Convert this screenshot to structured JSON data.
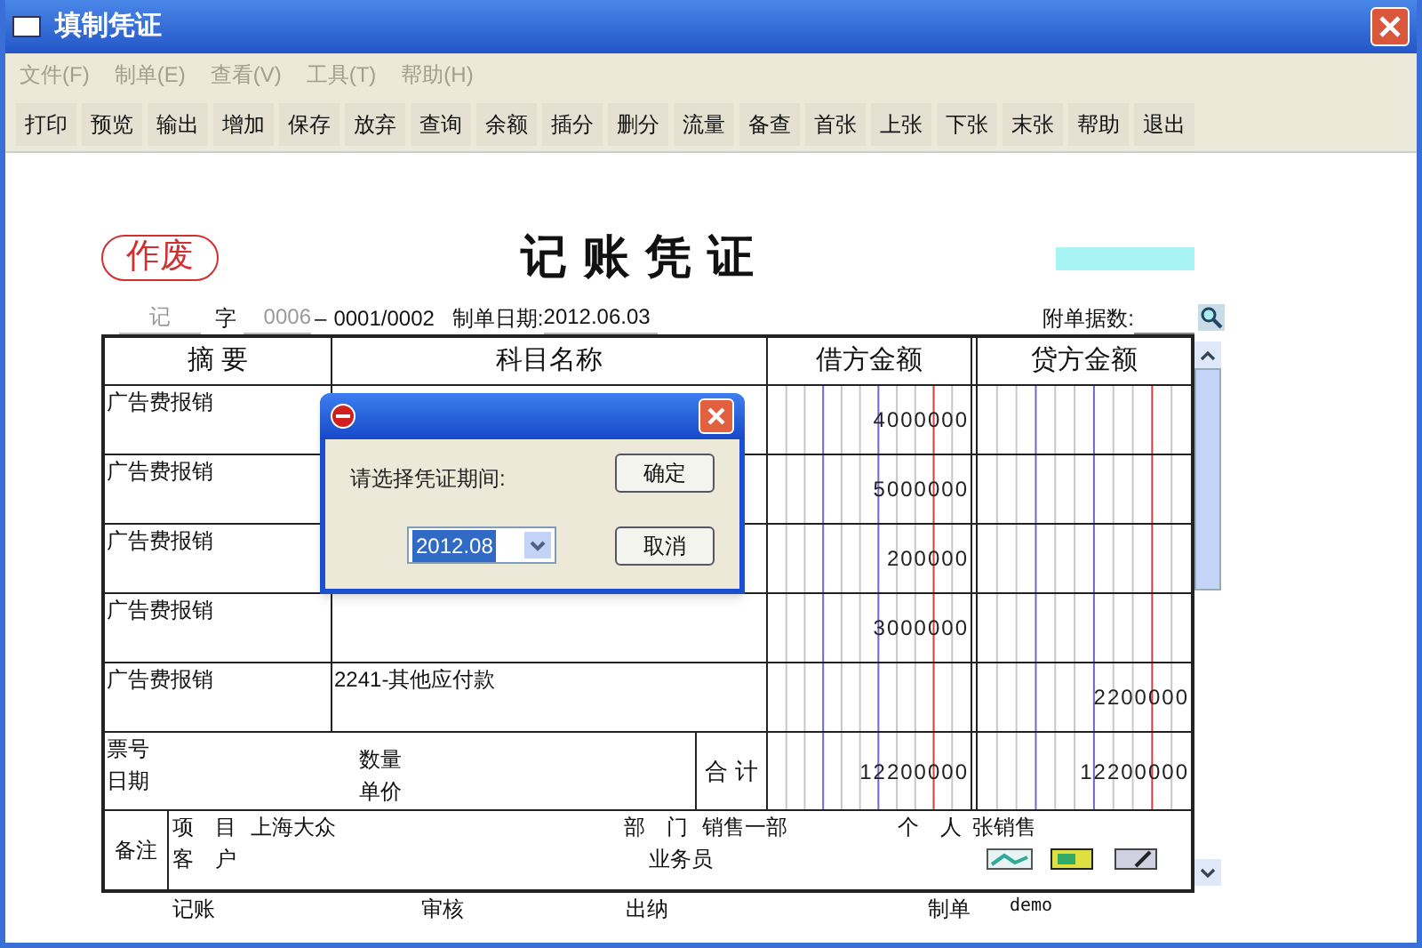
{
  "window": {
    "title": "填制凭证"
  },
  "menu": [
    {
      "label": "文件(F)",
      "disabled": true
    },
    {
      "label": "制单(E)",
      "disabled": true
    },
    {
      "label": "查看(V)",
      "disabled": true
    },
    {
      "label": "工具(T)",
      "disabled": true
    },
    {
      "label": "帮助(H)",
      "disabled": true
    }
  ],
  "toolbar": [
    "打印",
    "预览",
    "输出",
    "增加",
    "保存",
    "放弃",
    "查询",
    "余额",
    "插分",
    "删分",
    "流量",
    "备查",
    "首张",
    "上张",
    "下张",
    "末张",
    "帮助",
    "退出"
  ],
  "voucher": {
    "void_stamp": "作废",
    "title": "记 账 凭 证",
    "type": "记",
    "type_suffix": "字",
    "number": "0006",
    "separator": "–",
    "page": "0001/0002",
    "date_label": "制单日期:",
    "date": "2012.06.03",
    "attachments_label": "附单据数:"
  },
  "columns": [
    "摘 要",
    "科目名称",
    "借方金额",
    "贷方金额"
  ],
  "rows": [
    {
      "summary": "广告费报销",
      "debit": "4000000"
    },
    {
      "summary": "广告费报销",
      "debit": "5000000"
    },
    {
      "summary": "广告费报销",
      "debit": "200000"
    },
    {
      "summary": "广告费报销",
      "debit": "3000000"
    },
    {
      "summary": "广告费报销",
      "subject": "2241-其他应付款",
      "credit": "2200000"
    }
  ],
  "totals": {
    "ticket_label": "票号",
    "date_label": "日期",
    "quantity_label": "数量",
    "price_label": "单价",
    "total_label": "合 计",
    "debit": "12200000",
    "credit": "12200000"
  },
  "remarks": {
    "label": "备注",
    "project_label": "项　目",
    "project": "上海大众",
    "customer_label": "客　户",
    "department_label": "部　门",
    "department": "销售一部",
    "person_label": "个　人",
    "person": "张销售",
    "salesman_label": "业务员"
  },
  "footer": [
    {
      "label": "记账"
    },
    {
      "label": "审核"
    },
    {
      "label": "出纳"
    },
    {
      "label": "制单",
      "value": "demo"
    }
  ],
  "dialog": {
    "prompt": "请选择凭证期间:",
    "period": "2012.08",
    "buttons": [
      "确定",
      "取消"
    ]
  }
}
